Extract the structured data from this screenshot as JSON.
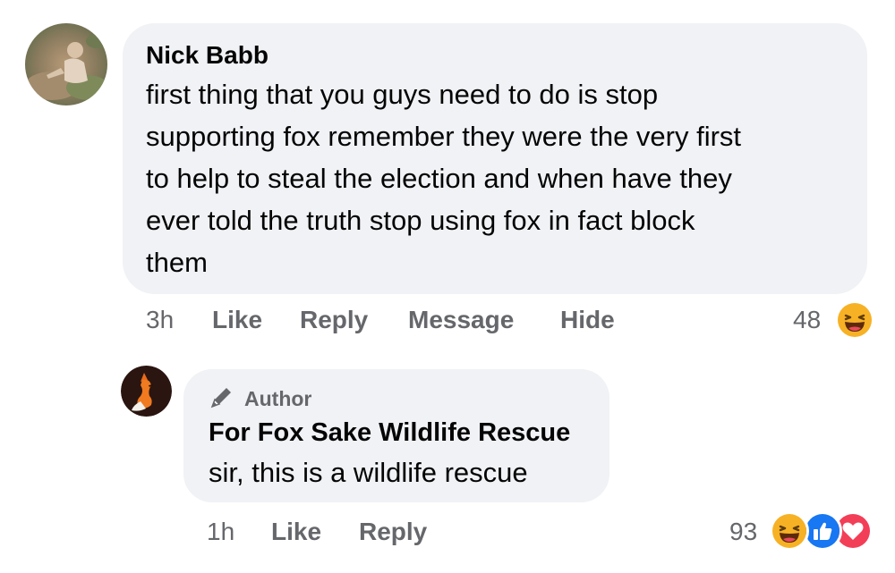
{
  "comment": {
    "author": "Nick Babb",
    "text": "first thing that you guys need to do is stop supporting fox remember they were the very first to help to steal the election and when have they ever told the truth stop using fox in fact block them",
    "lines": [
      "first thing that you guys need to do is stop",
      "supporting fox remember they were the very first",
      "to help to steal the election and when have they",
      "ever told the truth stop using fox in fact block",
      "them"
    ],
    "time": "3h",
    "actions": {
      "like": "Like",
      "reply": "Reply",
      "message": "Message",
      "hide": "Hide"
    },
    "reaction_count": "48",
    "reactions": [
      "haha-icon"
    ]
  },
  "reply": {
    "badge": "Author",
    "author": "For Fox Sake Wildlife Rescue",
    "text": "sir, this is a wildlife rescue",
    "time": "1h",
    "actions": {
      "like": "Like",
      "reply": "Reply"
    },
    "reaction_count": "93",
    "reactions": [
      "haha-icon",
      "like-icon",
      "love-icon"
    ]
  },
  "colors": {
    "bubble": "#f0f2f5",
    "meta_text": "#65676b",
    "like_blue": "#1877f2",
    "love_red": "#f33e58",
    "haha_yellow": "#f7b125"
  }
}
